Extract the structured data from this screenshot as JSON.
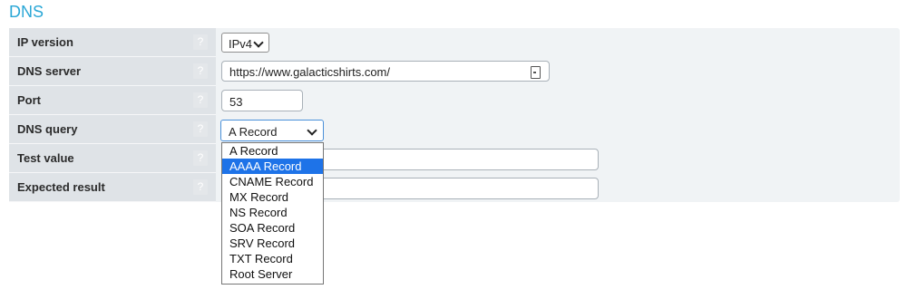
{
  "section": {
    "title": "DNS"
  },
  "help_glyph": "?",
  "rows": [
    {
      "label": "IP version"
    },
    {
      "label": "DNS server"
    },
    {
      "label": "Port"
    },
    {
      "label": "DNS query"
    },
    {
      "label": "Test value"
    },
    {
      "label": "Expected result"
    }
  ],
  "fields": {
    "ip_version": {
      "value": "IPv4"
    },
    "dns_server": {
      "value": "https://www.galacticshirts.com/"
    },
    "port": {
      "value": "53"
    },
    "dns_query": {
      "value": "A Record"
    },
    "test_value": {
      "value": ""
    },
    "expected_result": {
      "value": ""
    }
  },
  "dns_query_options": [
    "A Record",
    "AAAA Record",
    "CNAME Record",
    "MX Record",
    "NS Record",
    "SOA Record",
    "SRV Record",
    "TXT Record",
    "Root Server"
  ],
  "highlighted_option": "AAAA Record",
  "colors": {
    "accent": "#2aa7d6",
    "highlight": "#1e73e8",
    "label_bg": "#dfe3e7",
    "panel_bg": "#f0f3f5"
  }
}
